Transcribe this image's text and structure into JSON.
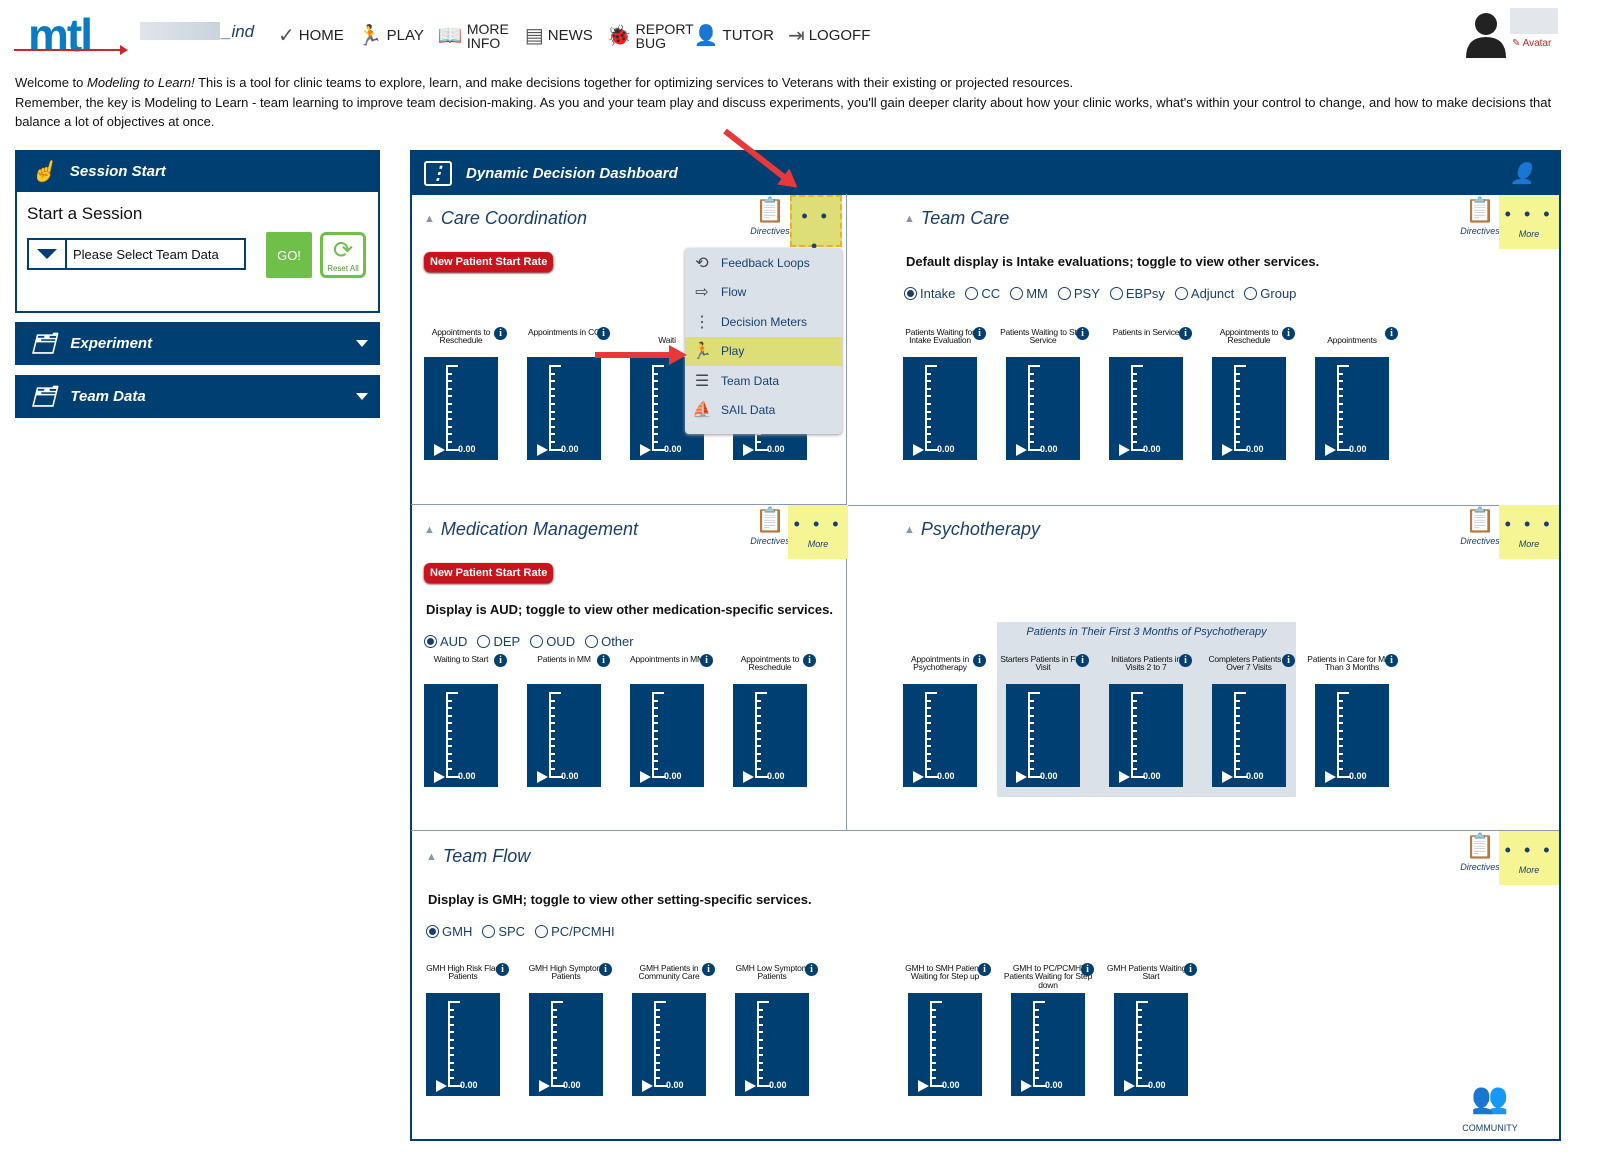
{
  "header": {
    "logo": "mtl",
    "user_suffix": "_ind",
    "nav": [
      {
        "label": "HOME",
        "icon": "checkmark-icon"
      },
      {
        "label": "PLAY",
        "icon": "play-figure-icon"
      },
      {
        "label": "MORE INFO",
        "icon": "book-icon"
      },
      {
        "label": "NEWS",
        "icon": "newspaper-icon"
      },
      {
        "label": "REPORT BUG",
        "icon": "bug-icon"
      },
      {
        "label": "TUTOR",
        "icon": "tutor-icon"
      },
      {
        "label": "LOGOFF",
        "icon": "logoff-icon"
      }
    ],
    "avatar_link": "✎ Avatar"
  },
  "intro": {
    "welcome": "Welcome to ",
    "app": "Modeling to Learn!",
    "line1": " This is a tool for clinic teams to explore, learn, and make decisions together for optimizing services to Veterans with their existing or projected resources.",
    "line2": "Remember, the key is Modeling to Learn - team learning to improve team decision-making. As you and your team play and discuss experiments, you'll gain deeper clarity about how your clinic works, what's within your control to change, and how to make decisions that balance a lot of objectives at once."
  },
  "sidebar": {
    "session_header": "Session Start",
    "session_title": "Start a Session",
    "select_value": "Please Select Team Data",
    "go": "GO!",
    "reset": "Reset All",
    "experiment": "Experiment",
    "team_data": "Team Data"
  },
  "dashboard": {
    "title": "Dynamic Decision Dashboard",
    "directives": "Directives",
    "more": "More",
    "community": "COMMUNITY",
    "more_menu": [
      {
        "label": "Feedback Loops",
        "icon": "feedback-loops-icon"
      },
      {
        "label": "Flow",
        "icon": "flow-arrow-icon"
      },
      {
        "label": "Decision Meters",
        "icon": "decision-meters-icon"
      },
      {
        "label": "Play",
        "icon": "play-figure-icon",
        "highlighted": true
      },
      {
        "label": "Team Data",
        "icon": "team-data-icon"
      },
      {
        "label": "SAIL Data",
        "icon": "sail-icon"
      }
    ],
    "care_coordination": {
      "title": "Care Coordination",
      "button": "New Patient Start Rate",
      "gauges": [
        {
          "label": "Appointments to Reschedule",
          "value": "0.00"
        },
        {
          "label": "Appointments in CC",
          "value": "0.00"
        },
        {
          "label": "Waiti",
          "value": "0.00"
        },
        {
          "label": "",
          "value": "0.00"
        }
      ]
    },
    "team_care": {
      "title": "Team Care",
      "description": "Default display is Intake evaluations; toggle to view other services.",
      "options": [
        "Intake",
        "CC",
        "MM",
        "PSY",
        "EBPsy",
        "Adjunct",
        "Group"
      ],
      "selected": "Intake",
      "gauges": [
        {
          "label": "Patients Waiting for Intake Evaluation",
          "value": "0.00"
        },
        {
          "label": "Patients Waiting to Start Service",
          "value": "0.00"
        },
        {
          "label": "Patients in Service",
          "value": "0.00"
        },
        {
          "label": "Appointments to Reschedule",
          "value": "0.00"
        },
        {
          "label": "Appointments",
          "value": "0.00"
        }
      ]
    },
    "medication_management": {
      "title": "Medication Management",
      "button": "New Patient Start Rate",
      "description": "Display is AUD; toggle to view other medication-specific services.",
      "options": [
        "AUD",
        "DEP",
        "OUD",
        "Other"
      ],
      "selected": "AUD",
      "gauges": [
        {
          "label": "Waiting to Start",
          "value": "0.00"
        },
        {
          "label": "Patients in MM",
          "value": "0.00"
        },
        {
          "label": "Appointments in MM",
          "value": "0.00"
        },
        {
          "label": "Appointments to Reschedule",
          "value": "0.00"
        }
      ]
    },
    "psychotherapy": {
      "title": "Psychotherapy",
      "group_title": "Patients in Their First 3 Months of Psychotherapy",
      "gauges": [
        {
          "label": "Appointments in Psychotherapy",
          "value": "0.00"
        },
        {
          "label": "Starters Patients in First Visit",
          "value": "0.00"
        },
        {
          "label": "Initiators Patients in Visits 2 to 7",
          "value": "0.00"
        },
        {
          "label": "Completers Patients in Over 7 Visits",
          "value": "0.00"
        },
        {
          "label": "Patients in Care for More Than 3 Months",
          "value": "0.00"
        }
      ]
    },
    "team_flow": {
      "title": "Team Flow",
      "description": "Display is GMH; toggle to view other setting-specific services.",
      "options": [
        "GMH",
        "SPC",
        "PC/PCMHI"
      ],
      "selected": "GMH",
      "gauges": [
        {
          "label": "GMH High Risk Flag Patients",
          "value": "0.00"
        },
        {
          "label": "GMH High Symptom Patients",
          "value": "0.00"
        },
        {
          "label": "GMH Patients in Community Care",
          "value": "0.00"
        },
        {
          "label": "GMH Low Symptom Patients",
          "value": "0.00"
        },
        {
          "label": "GMH to SMH Patients Waiting for Step up",
          "value": "0.00"
        },
        {
          "label": "GMH to PC/PCMHI Patients Waiting for Step down",
          "value": "0.00"
        },
        {
          "label": "GMH Patients Waiting to Start",
          "value": "0.00"
        }
      ]
    }
  },
  "colors": {
    "navy": "#003f72",
    "more_yellow": "#f6f594",
    "red_button": "#c8151d",
    "go_green": "#6fbf4a",
    "annotation_arrow": "#e8383a"
  }
}
